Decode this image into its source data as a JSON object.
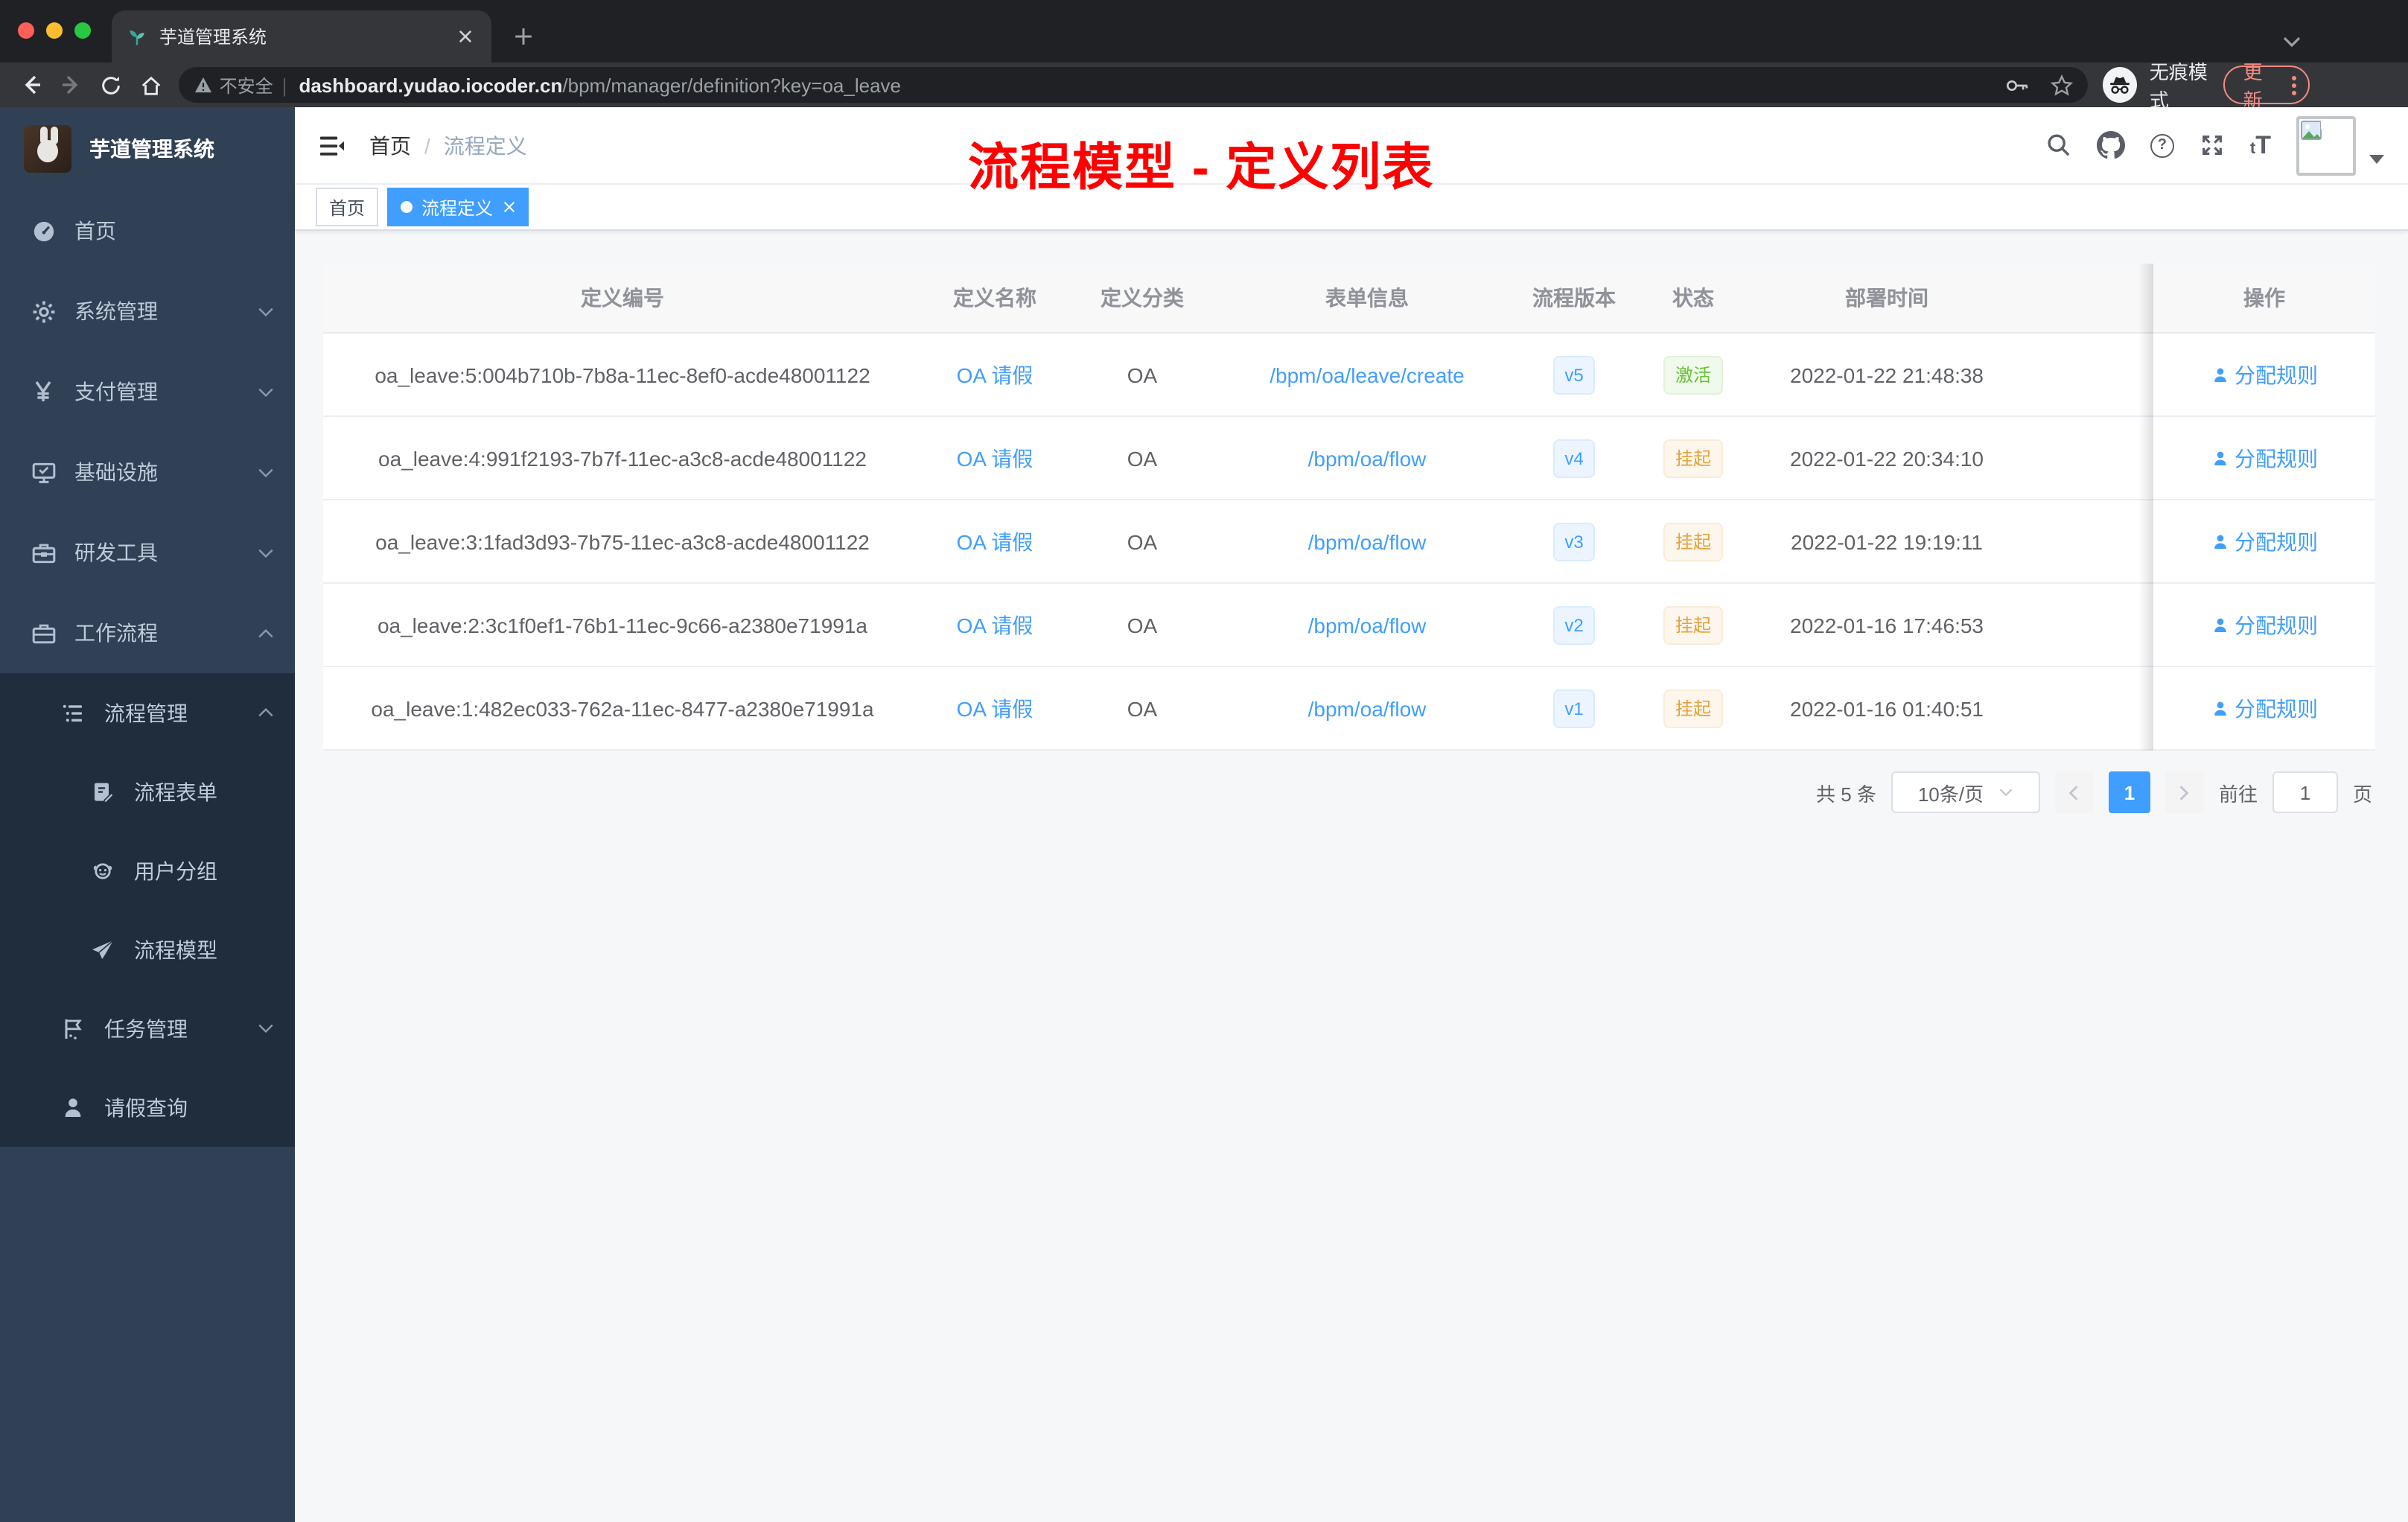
{
  "browser": {
    "tab_title": "芋道管理系统",
    "security_label": "不安全",
    "url_domain": "dashboard.yudao.iocoder.cn",
    "url_path": "/bpm/manager/definition?key=oa_leave",
    "incognito_label": "无痕模式",
    "update_label": "更新"
  },
  "sidebar": {
    "title": "芋道管理系统",
    "items": [
      {
        "label": "首页"
      },
      {
        "label": "系统管理"
      },
      {
        "label": "支付管理"
      },
      {
        "label": "基础设施"
      },
      {
        "label": "研发工具"
      },
      {
        "label": "工作流程"
      }
    ],
    "submenu": [
      {
        "label": "流程管理"
      },
      {
        "label": "流程表单"
      },
      {
        "label": "用户分组"
      },
      {
        "label": "流程模型"
      },
      {
        "label": "任务管理"
      },
      {
        "label": "请假查询"
      }
    ]
  },
  "navbar": {
    "breadcrumb_home": "首页",
    "breadcrumb_sep": "/",
    "breadcrumb_current": "流程定义",
    "help_glyph": "?",
    "fontsize_small": "t",
    "fontsize_big": "T"
  },
  "annotation": {
    "title": "流程模型 - 定义列表",
    "color": "#ff0000"
  },
  "tags": {
    "home": "首页",
    "active": "流程定义"
  },
  "table": {
    "columns": [
      "定义编号",
      "定义名称",
      "定义分类",
      "表单信息",
      "流程版本",
      "状态",
      "部署时间",
      "操作"
    ],
    "rows": [
      {
        "id": "oa_leave:5:004b710b-7b8a-11ec-8ef0-acde48001122",
        "name": "OA 请假",
        "category": "OA",
        "form": "/bpm/oa/leave/create",
        "version": "v5",
        "status": "激活",
        "status_type": "active",
        "deploy_time": "2022-01-22 21:48:38",
        "action": "分配规则"
      },
      {
        "id": "oa_leave:4:991f2193-7b7f-11ec-a3c8-acde48001122",
        "name": "OA 请假",
        "category": "OA",
        "form": "/bpm/oa/flow",
        "version": "v4",
        "status": "挂起",
        "status_type": "suspended",
        "deploy_time": "2022-01-22 20:34:10",
        "action": "分配规则"
      },
      {
        "id": "oa_leave:3:1fad3d93-7b75-11ec-a3c8-acde48001122",
        "name": "OA 请假",
        "category": "OA",
        "form": "/bpm/oa/flow",
        "version": "v3",
        "status": "挂起",
        "status_type": "suspended",
        "deploy_time": "2022-01-22 19:19:11",
        "action": "分配规则"
      },
      {
        "id": "oa_leave:2:3c1f0ef1-76b1-11ec-9c66-a2380e71991a",
        "name": "OA 请假",
        "category": "OA",
        "form": "/bpm/oa/flow",
        "version": "v2",
        "status": "挂起",
        "status_type": "suspended",
        "deploy_time": "2022-01-16 17:46:53",
        "action": "分配规则"
      },
      {
        "id": "oa_leave:1:482ec033-762a-11ec-8477-a2380e71991a",
        "name": "OA 请假",
        "category": "OA",
        "form": "/bpm/oa/flow",
        "version": "v1",
        "status": "挂起",
        "status_type": "suspended",
        "deploy_time": "2022-01-16 01:40:51",
        "action": "分配规则"
      }
    ]
  },
  "pagination": {
    "total": "共 5 条",
    "size": "10条/页",
    "page": "1",
    "goto_label": "前往",
    "goto_value": "1",
    "unit": "页"
  },
  "colors": {
    "accent_blue": "#409eff",
    "status_active_green": "#67c23a",
    "status_suspended_orange": "#e6a23c",
    "sidebar_bg": "#304156",
    "submenu_bg": "#1f2d3d",
    "update_red": "#f28b82"
  }
}
